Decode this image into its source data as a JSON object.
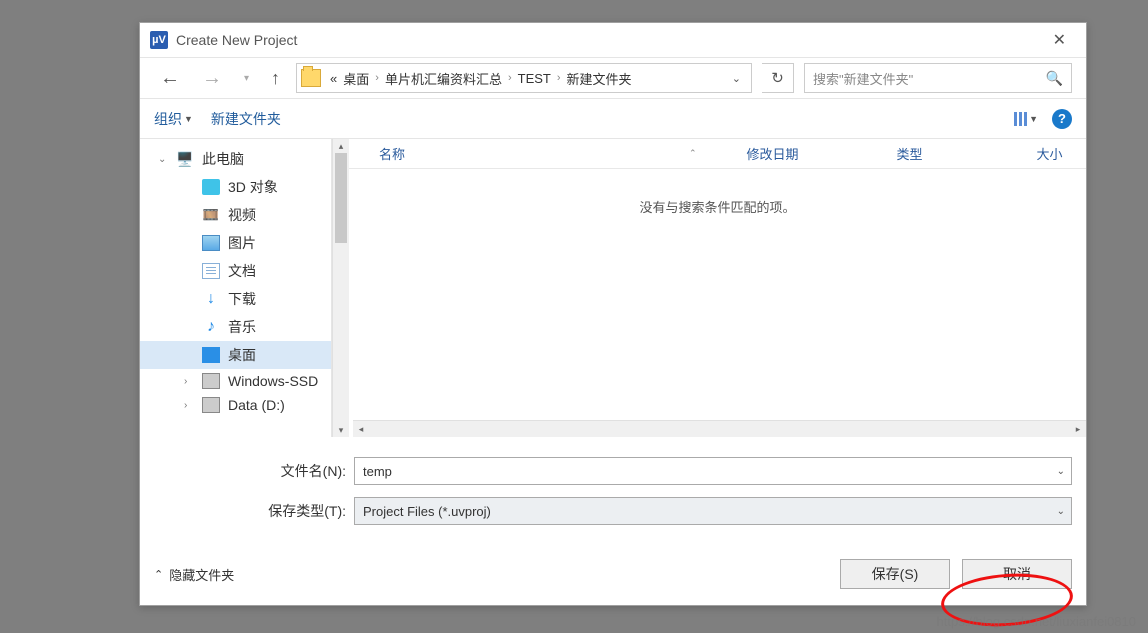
{
  "window": {
    "title": "Create New Project"
  },
  "breadcrumb": {
    "prefix": "«",
    "items": [
      "桌面",
      "单片机汇编资料汇总",
      "TEST",
      "新建文件夹"
    ]
  },
  "search": {
    "placeholder": "搜索\"新建文件夹\""
  },
  "toolbar": {
    "organize": "组织",
    "new_folder": "新建文件夹"
  },
  "sidebar": {
    "root": "此电脑",
    "items": [
      {
        "label": "3D 对象",
        "icon": "3d"
      },
      {
        "label": "视频",
        "icon": "video"
      },
      {
        "label": "图片",
        "icon": "pic"
      },
      {
        "label": "文档",
        "icon": "doc"
      },
      {
        "label": "下载",
        "icon": "down"
      },
      {
        "label": "音乐",
        "icon": "music"
      },
      {
        "label": "桌面",
        "icon": "desk",
        "selected": true
      },
      {
        "label": "Windows-SSD",
        "icon": "ssd"
      },
      {
        "label": "Data (D:)",
        "icon": "data"
      }
    ]
  },
  "columns": {
    "name": "名称",
    "date": "修改日期",
    "type": "类型",
    "size": "大小"
  },
  "empty_message": "没有与搜索条件匹配的项。",
  "form": {
    "filename_label": "文件名(N):",
    "filename_value": "temp",
    "type_label": "保存类型(T):",
    "type_value": "Project Files (*.uvproj)"
  },
  "footer": {
    "hide_folders": "隐藏文件夹",
    "save": "保存(S)",
    "cancel": "取消"
  },
  "watermark": "https://blog.csdn.net/liuxianfei0810"
}
